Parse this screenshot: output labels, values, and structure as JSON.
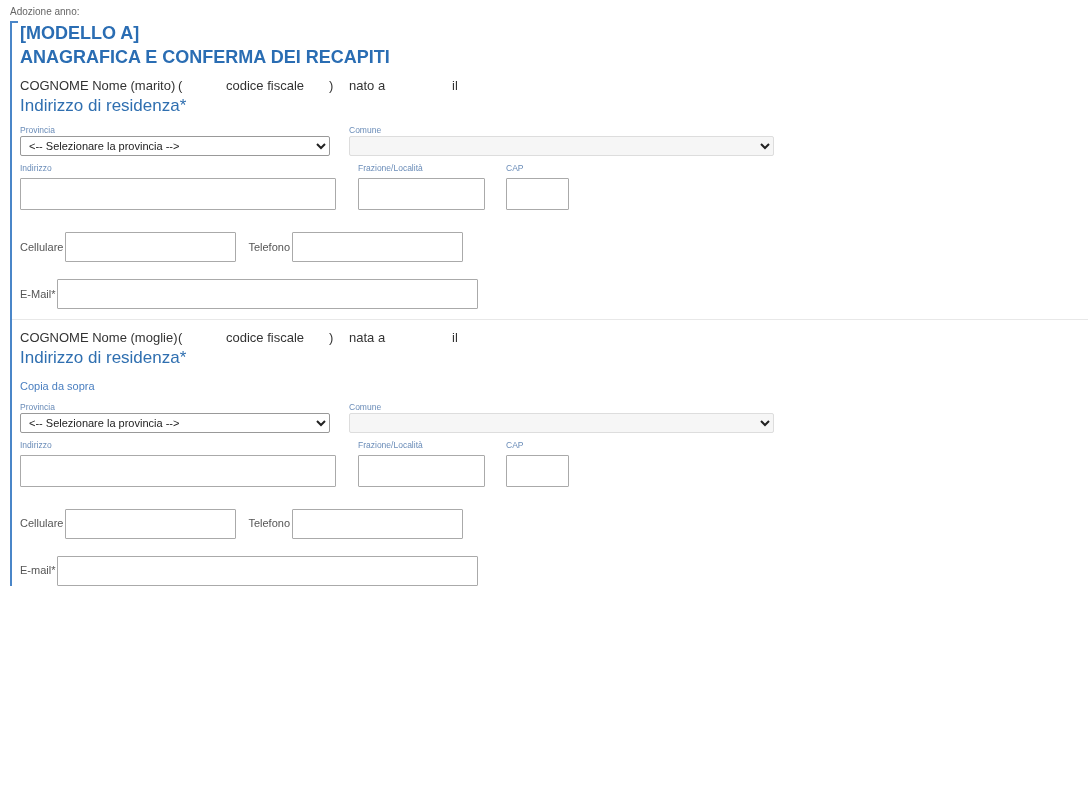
{
  "header": {
    "label": "Adozione anno:"
  },
  "section": {
    "title": "[MODELLO A]",
    "subtitle": "ANAGRAFICA E CONFERMA DEI RECAPITI"
  },
  "persons": [
    {
      "name": "COGNOME Nome (marito)",
      "open_paren": "(",
      "codice_fiscale": "codice fiscale",
      "close_paren": ")",
      "birth_label": "nato a",
      "date_label": "il",
      "address_heading": "Indirizzo di residenza*",
      "provincia_label": "Provincia",
      "provincia_value": "<-- Selezionare la provincia -->",
      "comune_label": "Comune",
      "comune_disabled": true,
      "indirizzo_label": "Indirizzo",
      "frazione_label": "Frazione/Località",
      "cap_label": "CAP",
      "cellulare_label": "Cellulare",
      "telefono_label": "Telefono",
      "email_label": "E-Mail*"
    },
    {
      "name": "COGNOME Nome (moglie)",
      "open_paren": "(",
      "codice_fiscale": "codice fiscale",
      "close_paren": ")",
      "birth_label": "nata a",
      "date_label": "il",
      "address_heading": "Indirizzo di residenza*",
      "copy_link": "Copia da sopra",
      "provincia_label": "Provincia",
      "provincia_value": "<-- Selezionare la provincia -->",
      "comune_label": "Comune",
      "comune_disabled": true,
      "indirizzo_label": "Indirizzo",
      "frazione_label": "Frazione/Località",
      "cap_label": "CAP",
      "cellulare_label": "Cellulare",
      "telefono_label": "Telefono",
      "email_label": "E-mail*"
    }
  ]
}
